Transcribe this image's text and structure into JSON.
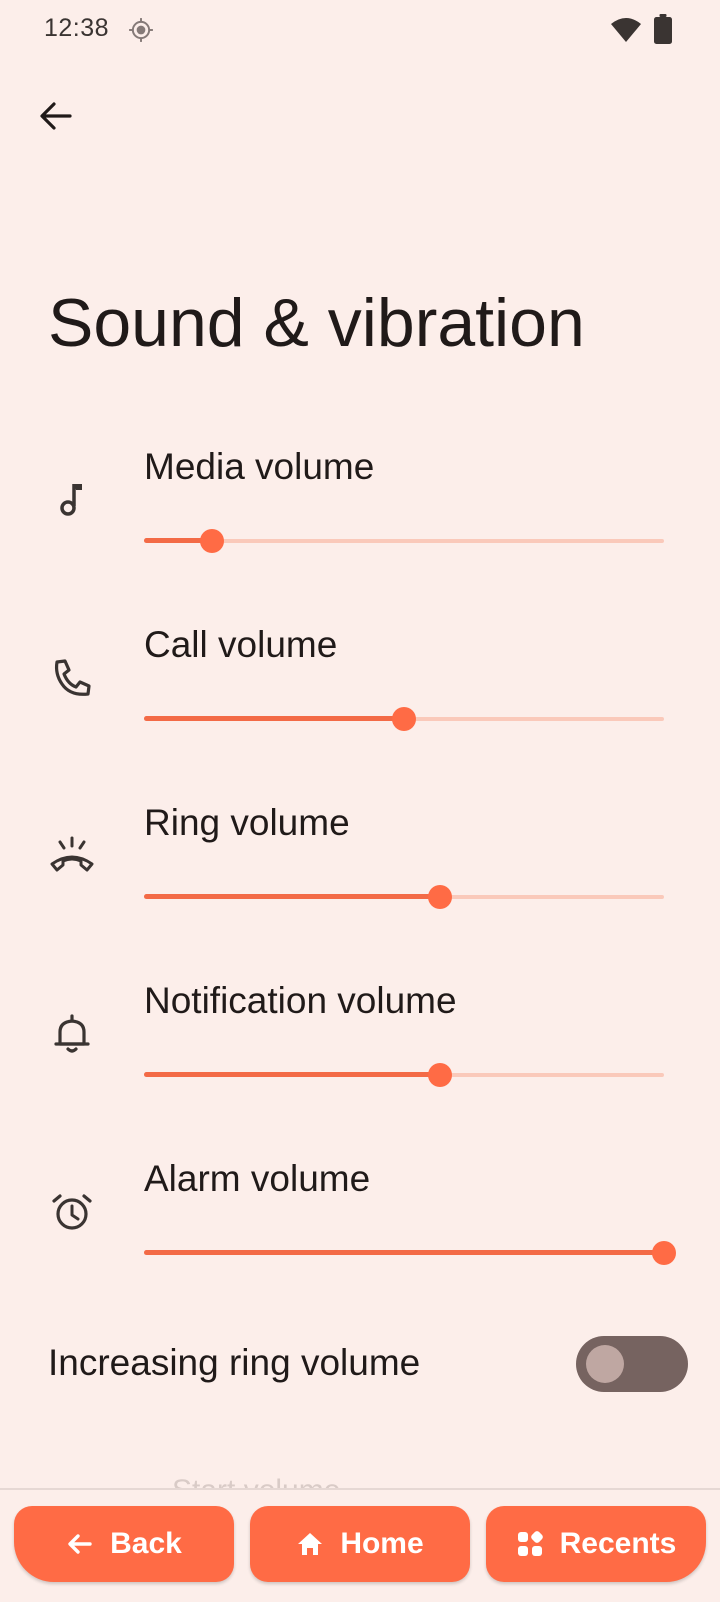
{
  "status_bar": {
    "time": "12:38",
    "icons": [
      "location-icon",
      "wifi-icon",
      "battery-icon"
    ]
  },
  "app_bar": {
    "back_icon": "arrow-back-icon"
  },
  "page": {
    "title": "Sound & vibration"
  },
  "volumes": [
    {
      "label": "Media volume",
      "icon": "music-note-icon",
      "level": 0.13
    },
    {
      "label": "Call volume",
      "icon": "phone-icon",
      "level": 0.5
    },
    {
      "label": "Ring volume",
      "icon": "ringing-phone-icon",
      "level": 0.57
    },
    {
      "label": "Notification volume",
      "icon": "bell-icon",
      "level": 0.57
    },
    {
      "label": "Alarm volume",
      "icon": "alarm-clock-icon",
      "level": 1.0
    }
  ],
  "increasing_ring": {
    "label": "Increasing ring volume",
    "enabled": false
  },
  "partial_item": {
    "label": "Start volume"
  },
  "nav": {
    "back_label": "Back",
    "home_label": "Home",
    "recents_label": "Recents"
  },
  "colors": {
    "background": "#FCEEEA",
    "accent": "#FF6B45",
    "slider_track": "#FAC9BA",
    "toggle_off_track": "#766360",
    "text_primary": "#201A19"
  }
}
